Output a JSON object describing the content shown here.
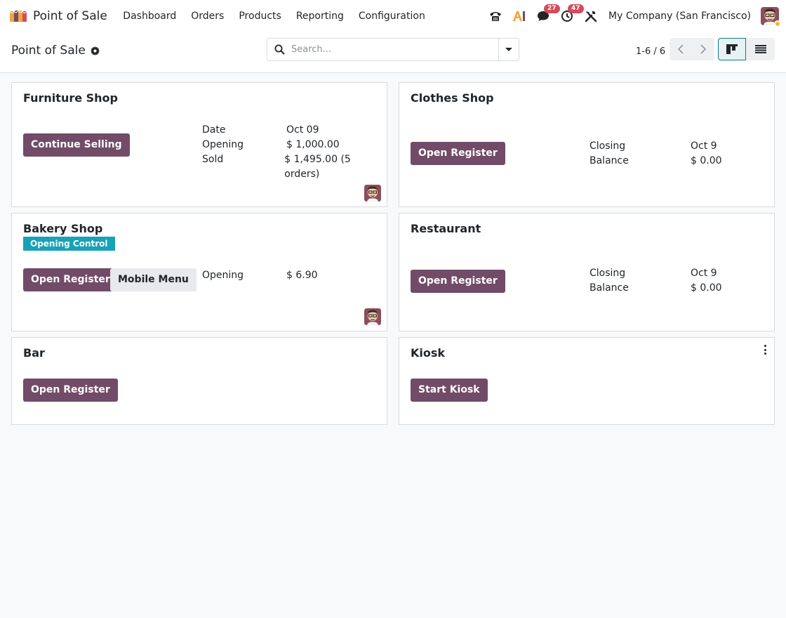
{
  "app": {
    "name": "Point of Sale",
    "menu": [
      "Dashboard",
      "Orders",
      "Products",
      "Reporting",
      "Configuration"
    ]
  },
  "systray": {
    "ai_label": "AI",
    "messages_count": "27",
    "activities_count": "47",
    "company": "My Company (San Francisco)"
  },
  "control_panel": {
    "title": "Point of Sale",
    "search_placeholder": "Search...",
    "pager": "1-6 / 6"
  },
  "colors": {
    "primary": "#714b67",
    "tag": "#17a2b8",
    "badge": "#d44c59",
    "accent": "#017e84"
  },
  "cards": {
    "furniture": {
      "title": "Furniture Shop",
      "button": "Continue Selling",
      "rows": [
        {
          "label": "Date",
          "value": "Oct 09"
        },
        {
          "label": "Opening",
          "value": "$ 1,000.00"
        },
        {
          "label": "Sold",
          "value": "$ 1,495.00 (5 orders)"
        }
      ]
    },
    "clothes": {
      "title": "Clothes Shop",
      "button": "Open Register",
      "rows": [
        {
          "label": "Closing",
          "value": "Oct 9"
        },
        {
          "label": "Balance",
          "value": "$ 0.00"
        }
      ]
    },
    "bakery": {
      "title": "Bakery Shop",
      "tag": "Opening Control",
      "button": "Open Register",
      "button2": "Mobile Menu",
      "rows": [
        {
          "label": "Opening",
          "value": "$ 6.90"
        }
      ]
    },
    "restaurant": {
      "title": "Restaurant",
      "button": "Open Register",
      "rows": [
        {
          "label": "Closing",
          "value": "Oct 9"
        },
        {
          "label": "Balance",
          "value": "$ 0.00"
        }
      ]
    },
    "bar": {
      "title": "Bar",
      "button": "Open Register"
    },
    "kiosk": {
      "title": "Kiosk",
      "button": "Start Kiosk"
    }
  }
}
